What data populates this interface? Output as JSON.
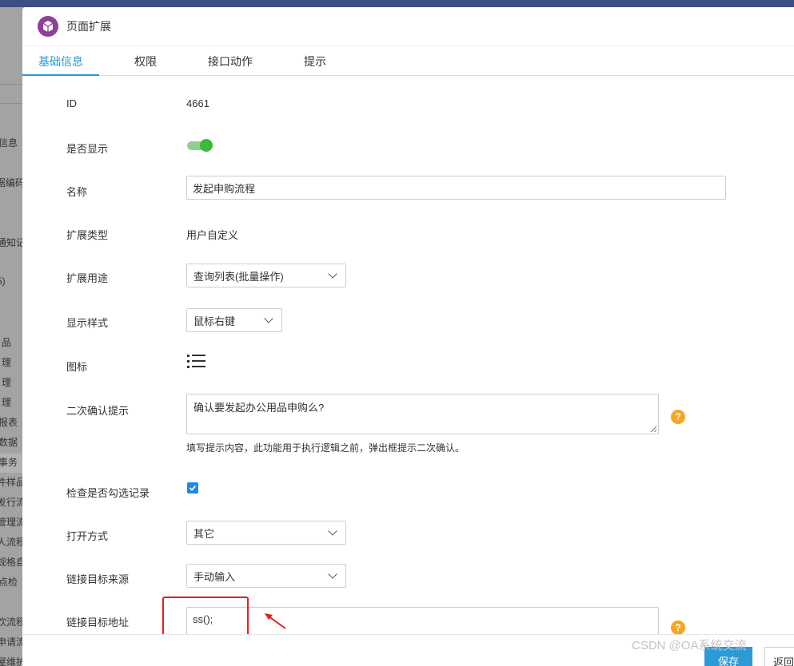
{
  "background": {
    "sidebar_items": [
      "信息",
      "据编码",
      "通知记",
      "5)",
      "品",
      "理",
      "理",
      "理",
      "报表",
      "数据",
      "事务",
      "件样品",
      "发行流",
      "管理流",
      "人流程",
      "规格自",
      "点检",
      "饮流程",
      "申请流",
      "屋维护"
    ]
  },
  "dialog": {
    "title": "页面扩展",
    "tabs": [
      {
        "label": "基础信息",
        "active": true
      },
      {
        "label": "权限",
        "active": false
      },
      {
        "label": "接口动作",
        "active": false
      },
      {
        "label": "提示",
        "active": false
      }
    ]
  },
  "form": {
    "id_label": "ID",
    "id_value": "4661",
    "visible_label": "是否显示",
    "visible_on": true,
    "name_label": "名称",
    "name_value": "发起申购流程",
    "ext_type_label": "扩展类型",
    "ext_type_value": "用户自定义",
    "purpose_label": "扩展用途",
    "purpose_value": "查询列表(批量操作)",
    "display_style_label": "显示样式",
    "display_style_value": "鼠标右键",
    "icon_label": "图标",
    "icon_name": "list-icon",
    "confirm_label": "二次确认提示",
    "confirm_value": "确认要发起办公用品申购么?",
    "confirm_hint": "填写提示内容，此功能用于执行逻辑之前，弹出框提示二次确认。",
    "check_label": "检查是否勾选记录",
    "check_checked": true,
    "open_label": "打开方式",
    "open_value": "其它",
    "link_source_label": "链接目标来源",
    "link_source_value": "手动输入",
    "link_addr_label": "链接目标地址",
    "link_addr_value": "ss();",
    "help_mark": "?"
  },
  "footer": {
    "save_label": "保存",
    "back_label": "返回"
  },
  "watermark": "CSDN @OA系统交流",
  "colors": {
    "accent": "#2b9ad6",
    "toggle_on": "#3dba3a",
    "help": "#f5a623",
    "annotation_red": "#e01e1e"
  }
}
